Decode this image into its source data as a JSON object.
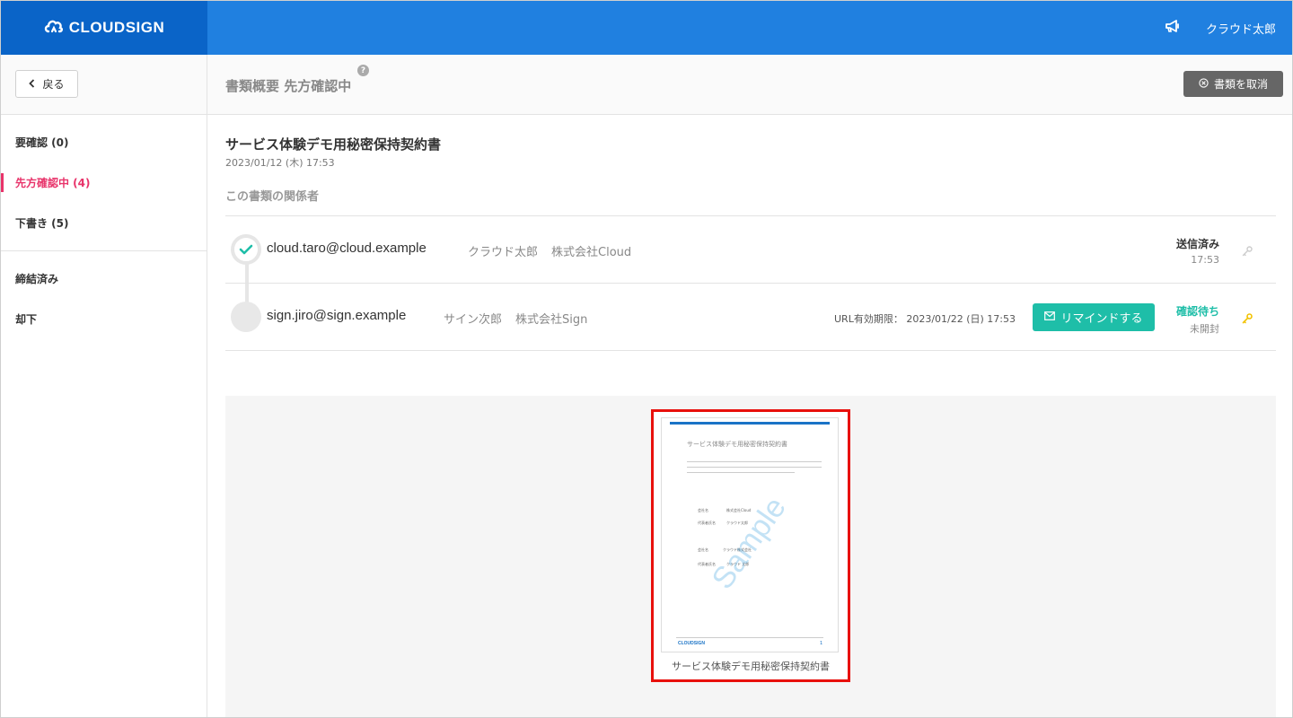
{
  "header": {
    "brand": "CLOUDSIGN",
    "user_name": "クラウド太郎"
  },
  "sidebar": {
    "back_label": "戻る",
    "group1": [
      {
        "label": "要確認 (0)"
      },
      {
        "label": "先方確認中 (4)"
      },
      {
        "label": "下書き (5)"
      }
    ],
    "group2": [
      {
        "label": "締結済み"
      },
      {
        "label": "却下"
      }
    ]
  },
  "main": {
    "page_title": "書類概要 先方確認中",
    "help": "?",
    "cancel_label": "書類を取消",
    "doc_title": "サービス体験デモ用秘密保持契約書",
    "doc_date": "2023/01/12 (木) 17:53",
    "section_label": "この書類の関係者",
    "parties": [
      {
        "email": "cloud.taro@cloud.example",
        "name": "クラウド太郎",
        "company": "株式会社Cloud",
        "status": "送信済み",
        "status_sub": "17:53"
      },
      {
        "email": "sign.jiro@sign.example",
        "name": "サイン次郎",
        "company": "株式会社Sign",
        "url_expiry": "URL有効期限： 2023/01/22 (日) 17:53",
        "remind_label": "リマインドする",
        "status": "確認待ち",
        "status_sub": "未開封"
      }
    ],
    "preview": {
      "paper_title": "サービス体験デモ用秘密保持契約書",
      "watermark": "Sample",
      "field1_label": "会社名",
      "field1_value": "株式会社Cloud",
      "field2_label": "代表者氏名",
      "field2_value": "クラウド太郎",
      "field3_label": "会社名",
      "field3_value": "クラウド株式会社",
      "field4_label": "代表者氏名",
      "field4_value": "クラウド 太郎",
      "footer_logo": "CLOUDSIGN",
      "page_no": "1",
      "caption": "サービス体験デモ用秘密保持契約書"
    }
  },
  "colors": {
    "header_blue": "#2080e0",
    "brand_blue": "#0a64c8",
    "active_pink": "#e8336a",
    "teal": "#1ebea8",
    "highlight_red": "#e8100c"
  }
}
